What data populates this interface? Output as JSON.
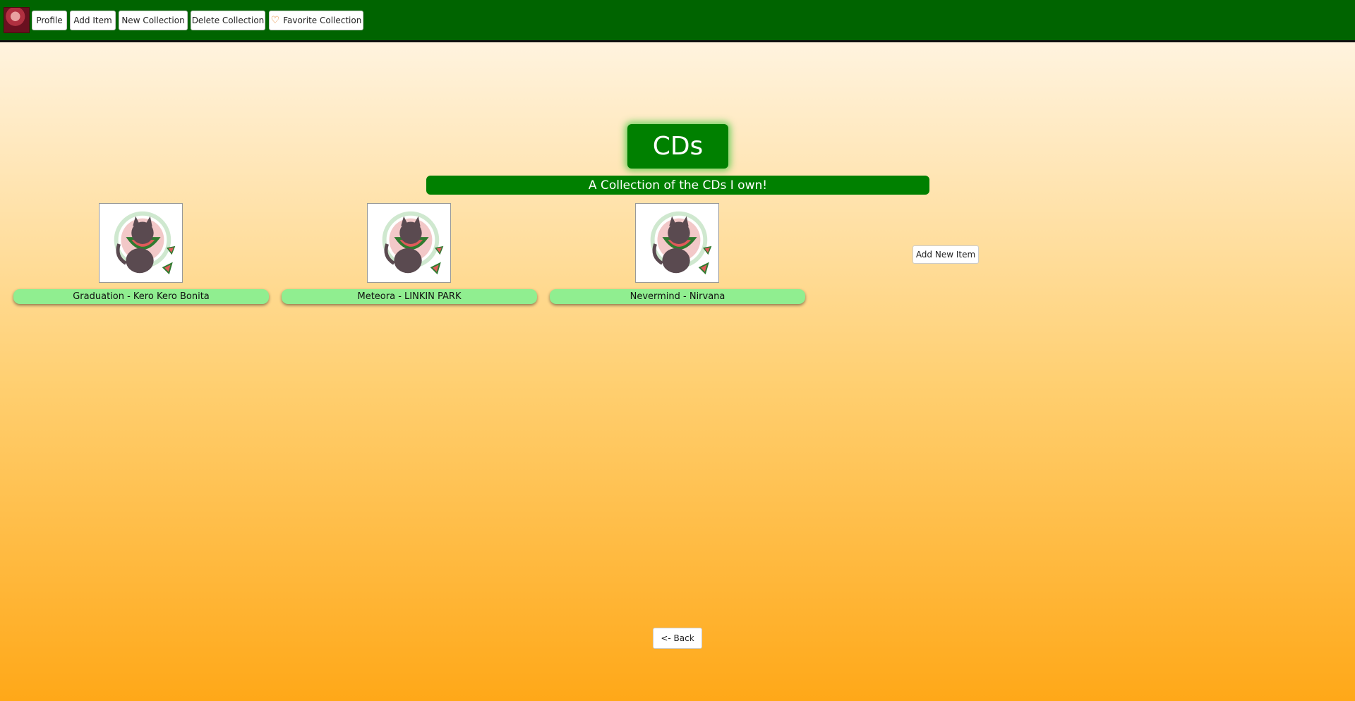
{
  "nav": {
    "avatar_icon": "user-avatar",
    "profile": "Profile",
    "add_item": "Add Item",
    "new_collection": "New Collection",
    "delete_collection": "Delete Collection",
    "favorite_collection": "Favorite Collection",
    "favorite_icon": "heart-outline-icon"
  },
  "collection": {
    "title": "CDs",
    "description": "A Collection of the CDs I own!"
  },
  "items": [
    {
      "label": "Graduation - Kero Kero Bonita",
      "image_icon": "cat-watermelon-image"
    },
    {
      "label": "Meteora - LINKIN PARK",
      "image_icon": "cat-watermelon-image"
    },
    {
      "label": "Nevermind - Nirvana",
      "image_icon": "cat-watermelon-image"
    }
  ],
  "actions": {
    "add_new_item": "Add New Item",
    "back": "<- Back"
  },
  "colors": {
    "header": "#006400",
    "title_bg": "#008000",
    "item_label_bg": "#90ee90",
    "gradient_top": "#fff8ec",
    "gradient_bottom": "#ffa818"
  }
}
